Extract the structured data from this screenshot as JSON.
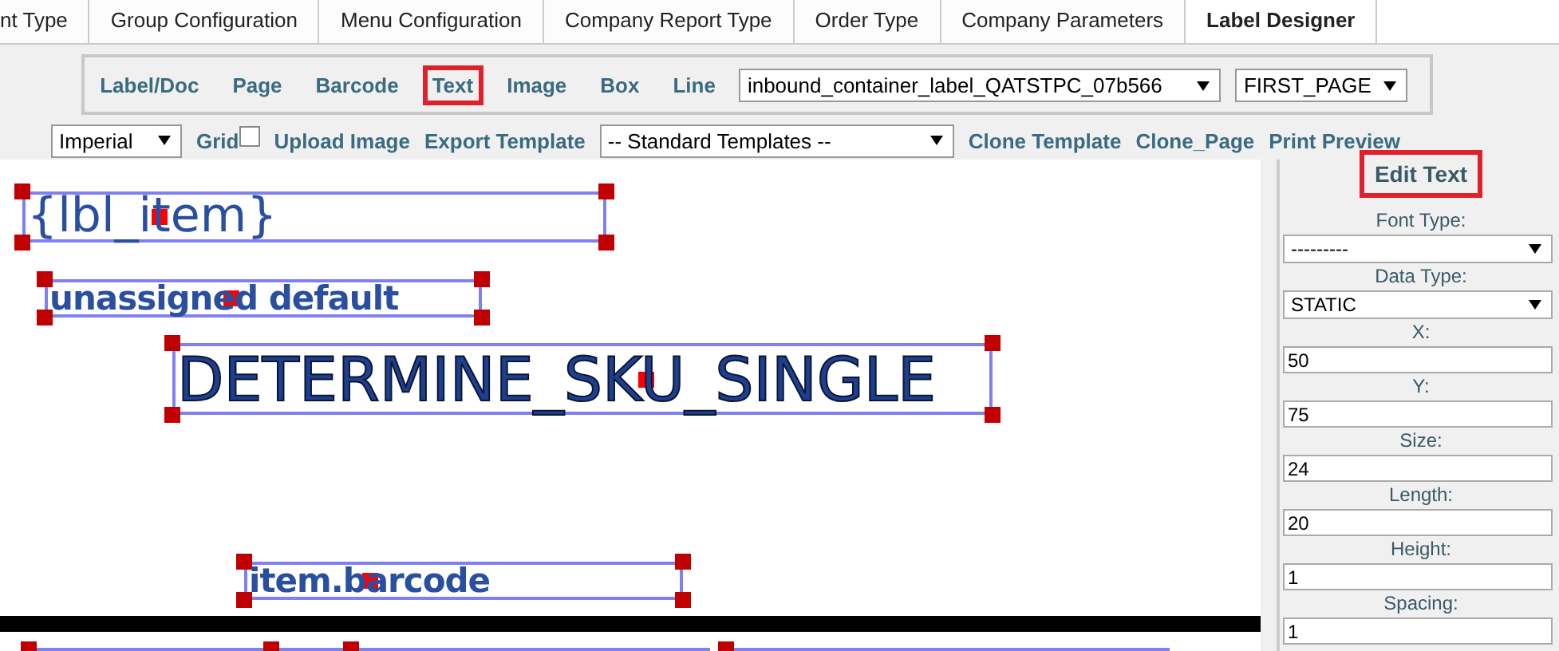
{
  "tabs": [
    {
      "label": "nt Type",
      "selected": false
    },
    {
      "label": "Group Configuration",
      "selected": false
    },
    {
      "label": "Menu Configuration",
      "selected": false
    },
    {
      "label": "Company Report Type",
      "selected": false
    },
    {
      "label": "Order Type",
      "selected": false
    },
    {
      "label": "Company Parameters",
      "selected": false
    },
    {
      "label": "Label Designer",
      "selected": true
    }
  ],
  "toolbar": {
    "tools": [
      {
        "label": "Label/Doc",
        "selected": false
      },
      {
        "label": "Page",
        "selected": false
      },
      {
        "label": "Barcode",
        "selected": false
      },
      {
        "label": "Text",
        "selected": true
      },
      {
        "label": "Image",
        "selected": false
      },
      {
        "label": "Box",
        "selected": false
      },
      {
        "label": "Line",
        "selected": false
      }
    ],
    "template_select": "inbound_container_label_QATSTPC_07b566",
    "page_select": "FIRST_PAGE"
  },
  "toolbar2": {
    "units_select": "Imperial",
    "grid": {
      "label": "Grid",
      "checked": false
    },
    "actions_left": [
      "Upload Image",
      "Export Template"
    ],
    "standard_templates_select": "-- Standard Templates --",
    "actions_right": [
      "Clone Template",
      "Clone_Page",
      "Print Preview"
    ]
  },
  "canvas": {
    "elements": [
      {
        "text": "{lbl_item}",
        "kind": "regular"
      },
      {
        "text": "unassigned default",
        "kind": "bold"
      },
      {
        "text": "DETERMINE_SKU_SINGLE",
        "kind": "outlined"
      },
      {
        "text": "item.barcode",
        "kind": "bold"
      }
    ]
  },
  "panel": {
    "title": "Edit Text",
    "fields": [
      {
        "label": "Font Type:",
        "kind": "select",
        "value": "---------"
      },
      {
        "label": "Data Type:",
        "kind": "select",
        "value": "STATIC"
      },
      {
        "label": "X:",
        "kind": "input",
        "value": "50"
      },
      {
        "label": "Y:",
        "kind": "input",
        "value": "75"
      },
      {
        "label": "Size:",
        "kind": "input",
        "value": "24"
      },
      {
        "label": "Length:",
        "kind": "input",
        "value": "20"
      },
      {
        "label": "Height:",
        "kind": "input",
        "value": "1"
      },
      {
        "label": "Spacing:",
        "kind": "input",
        "value": "1"
      }
    ]
  }
}
